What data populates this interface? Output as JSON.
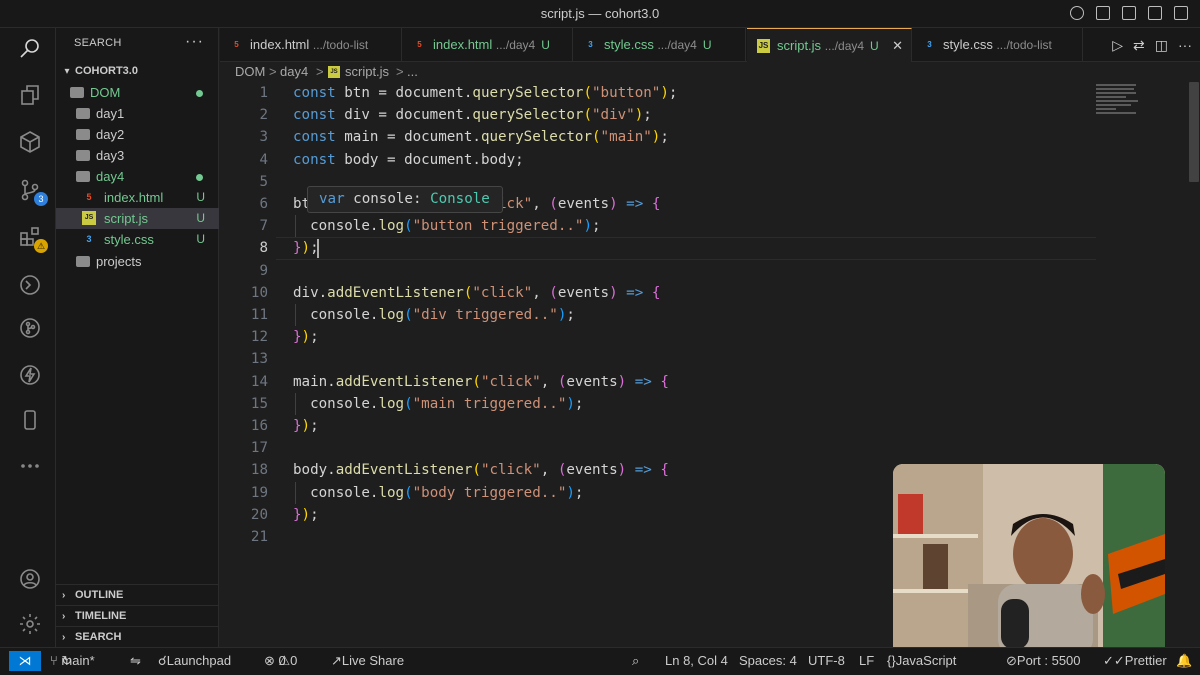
{
  "window": {
    "title": "script.js — cohort3.0"
  },
  "sidebar": {
    "header": "SEARCH",
    "workspace": "COHORT3.0",
    "tree": [
      {
        "label": "DOM",
        "type": "folder",
        "status": "dot"
      },
      {
        "label": "day1",
        "type": "folder",
        "status": ""
      },
      {
        "label": "day2",
        "type": "folder",
        "status": ""
      },
      {
        "label": "day3",
        "type": "folder",
        "status": ""
      },
      {
        "label": "day4",
        "type": "folder",
        "status": "dot"
      },
      {
        "label": "index.html",
        "type": "html",
        "status": "U"
      },
      {
        "label": "script.js",
        "type": "js",
        "status": "U"
      },
      {
        "label": "style.css",
        "type": "css",
        "status": "U"
      },
      {
        "label": "projects",
        "type": "folder",
        "status": ""
      }
    ],
    "sections": [
      "OUTLINE",
      "TIMELINE",
      "SEARCH"
    ]
  },
  "activity": {
    "source_control_badge": "3",
    "extensions_badge": "⚠"
  },
  "tabs": [
    {
      "name": "index.html",
      "path": ".../todo-list",
      "status": "",
      "type": "html"
    },
    {
      "name": "index.html",
      "path": ".../day4",
      "status": "U",
      "type": "html"
    },
    {
      "name": "style.css",
      "path": ".../day4",
      "status": "U",
      "type": "css"
    },
    {
      "name": "script.js",
      "path": ".../day4",
      "status": "U",
      "type": "js",
      "active": true
    },
    {
      "name": "style.css",
      "path": ".../todo-list",
      "status": "",
      "type": "css"
    }
  ],
  "tab_icons": {
    "html": "5",
    "css": "3",
    "js": "JS"
  },
  "breadcrumbs": [
    "DOM",
    ">",
    "day4",
    ">",
    "JS",
    "script.js",
    ">",
    "..."
  ],
  "editor": {
    "lines": [
      "1",
      "2",
      "3",
      "4",
      "5",
      "6",
      "7",
      "8",
      "9",
      "10",
      "11",
      "12",
      "13",
      "14",
      "15",
      "16",
      "17",
      "18",
      "19",
      "20",
      "21"
    ],
    "current_line": 8
  },
  "hover_tooltip": {
    "keyword": "var",
    "name": "console:",
    "type": "Console"
  },
  "status": {
    "branch": "main*",
    "launchpad": "Launchpad",
    "errors": "0",
    "warnings": "0",
    "live_share": "Live Share",
    "position": "Ln 8, Col 4",
    "spaces": "Spaces: 4",
    "encoding": "UTF-8",
    "eol": "LF",
    "language": "JavaScript",
    "port": "Port : 5500",
    "prettier": "Prettier"
  }
}
